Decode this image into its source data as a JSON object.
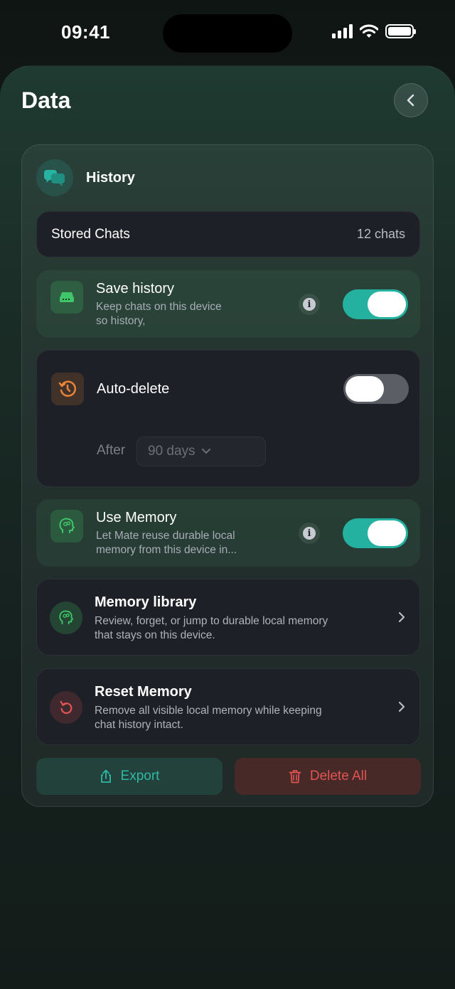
{
  "status": {
    "time": "09:41"
  },
  "page": {
    "title": "Data"
  },
  "history": {
    "title": "History",
    "stored_chats": {
      "label": "Stored Chats",
      "value": "12 chats"
    },
    "save_history": {
      "title": "Save history",
      "subtitle_line1": "Keep chats on this device",
      "subtitle_line2": "so history,",
      "enabled": true
    },
    "auto_delete": {
      "title": "Auto-delete",
      "enabled": false,
      "after_label": "After",
      "after_value": "90 days"
    },
    "use_memory": {
      "title": "Use Memory",
      "subtitle_line1": "Let Mate reuse durable local",
      "subtitle_line2": "memory from this device in...",
      "enabled": true
    },
    "memory_library": {
      "title": "Memory library",
      "subtitle_line1": "Review, forget, or jump to durable local memory",
      "subtitle_line2": "that stays on this device."
    },
    "reset_memory": {
      "title": "Reset Memory",
      "subtitle_line1": "Remove all visible local memory while keeping",
      "subtitle_line2": "chat history intact."
    },
    "export_label": "Export",
    "delete_label": "Delete All"
  },
  "colors": {
    "accent": "#25b1a0",
    "danger": "#e05454",
    "warning": "#e8853a",
    "memory": "#3fc56a"
  }
}
